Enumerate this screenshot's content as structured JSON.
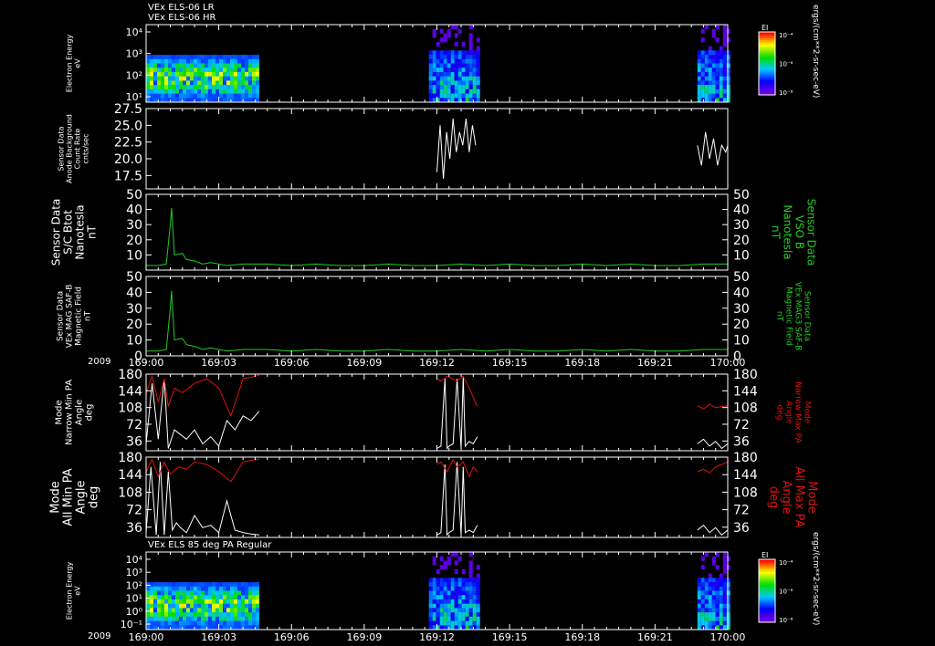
{
  "header": {
    "title_lines": [
      "VEx ELS-06 LR",
      "VEx ELS-06 HR"
    ],
    "bottom_title": "VEx ELS 85 deg PA Regular"
  },
  "time_axis": {
    "year": "2009",
    "ticks": [
      "169:00",
      "169:03",
      "169:06",
      "169:09",
      "169:12",
      "169:15",
      "169:18",
      "169:21",
      "170:00"
    ],
    "minutes": [
      0,
      180,
      360,
      540,
      720,
      900,
      1080,
      1260,
      1440
    ]
  },
  "colors": {
    "white": "#ffffff",
    "green": "#22cc22",
    "red": "#dd1111",
    "frame": "#ffffff"
  },
  "chart_data": [
    {
      "type": "heatmap",
      "ylabel": [
        "Electron Energy",
        "eV"
      ],
      "yticks": [
        "10⁴",
        "10³",
        "10²",
        "10¹"
      ],
      "colorbar_label": "EI",
      "colorbar_ticks": [
        "10⁻⁴",
        "10⁻⁶",
        "10⁻⁸"
      ],
      "colorbar_unit": "ergs/(cm**2-sr-sec-eV)",
      "data_intervals_minutes": [
        [
          0,
          280
        ],
        [
          700,
          820
        ],
        [
          1365,
          1440
        ]
      ]
    },
    {
      "type": "line",
      "ylabel": [
        "Sensor Data",
        "Anode Background",
        "Count Rate",
        "cnts/sec"
      ],
      "ylim": [
        15.5,
        27.5
      ],
      "yticks": [
        "27.5",
        "25.0",
        "22.5",
        "20.0",
        "17.5"
      ],
      "series": [
        {
          "color": "#ffffff",
          "x": [
            720,
            728,
            736,
            744,
            752,
            760,
            768,
            776,
            784,
            792,
            800,
            808,
            816
          ],
          "values": [
            18,
            25,
            17,
            24,
            20,
            26,
            21,
            24,
            22,
            26,
            21,
            25,
            22
          ]
        },
        {
          "color": "#ffffff",
          "x": [
            1365,
            1375,
            1385,
            1395,
            1405,
            1415,
            1425,
            1435,
            1440
          ],
          "values": [
            22,
            19,
            24,
            20,
            23,
            19,
            22,
            21,
            22
          ]
        }
      ]
    },
    {
      "type": "line",
      "ylabel": [
        "Sensor Data",
        "S/C Btot",
        "Nanotesla",
        "nT"
      ],
      "rlabel": [
        "Sensor Data",
        "VSO B",
        "Nanotesla",
        "nT"
      ],
      "ylim": [
        0,
        50
      ],
      "yticks": [
        "50",
        "40",
        "30",
        "20",
        "10"
      ],
      "series": [
        {
          "color": "#22cc22",
          "x": [
            0,
            30,
            50,
            60,
            63,
            70,
            90,
            100,
            120,
            140,
            160,
            200,
            240,
            300,
            360,
            420,
            480,
            540,
            600,
            660,
            720,
            780,
            840,
            900,
            960,
            1020,
            1080,
            1140,
            1200,
            1260,
            1320,
            1380,
            1440
          ],
          "values": [
            3,
            3,
            4,
            30,
            41,
            10,
            11,
            7,
            6,
            4,
            5,
            3,
            4,
            4,
            3,
            4,
            3,
            3,
            4,
            3,
            3,
            4,
            3,
            4,
            3,
            3,
            4,
            3,
            4,
            3,
            3,
            4,
            4
          ]
        }
      ]
    },
    {
      "type": "line",
      "ylabel": [
        "Sensor Data",
        "VEx MAG SAF-B",
        "Magnetic Field",
        "nT"
      ],
      "rlabel": [
        "Sensor Data",
        "VEx MAG3 SAF-B",
        "Magnetic Field",
        "nT"
      ],
      "ylim": [
        0,
        50
      ],
      "yticks": [
        "50",
        "40",
        "30",
        "20",
        "10",
        "0"
      ],
      "series": [
        {
          "color": "#22cc22",
          "x": [
            0,
            30,
            50,
            60,
            63,
            70,
            90,
            100,
            120,
            140,
            160,
            200,
            240,
            300,
            360,
            420,
            480,
            540,
            600,
            660,
            720,
            780,
            840,
            900,
            960,
            1020,
            1080,
            1140,
            1200,
            1260,
            1320,
            1380,
            1440
          ],
          "values": [
            3,
            3,
            4,
            30,
            41,
            10,
            11,
            7,
            6,
            4,
            5,
            3,
            4,
            4,
            3,
            4,
            3,
            3,
            4,
            3,
            3,
            4,
            3,
            4,
            3,
            3,
            4,
            3,
            4,
            3,
            3,
            4,
            4
          ]
        }
      ]
    },
    {
      "type": "line",
      "ylabel": [
        "Mode",
        "Narrow Min PA",
        "Angle",
        "deg"
      ],
      "rlabel": [
        "Mode",
        "Narrow Max PA",
        "Angle",
        "deg"
      ],
      "ylim": [
        15,
        180
      ],
      "yticks": [
        "180",
        "144",
        "108",
        "72",
        "36"
      ],
      "series": [
        {
          "color": "#ffffff",
          "x": [
            0,
            15,
            30,
            45,
            55,
            70,
            85,
            100,
            120,
            140,
            160,
            180,
            200,
            220,
            240,
            260,
            280
          ],
          "values": [
            30,
            160,
            40,
            170,
            20,
            60,
            50,
            40,
            60,
            30,
            45,
            25,
            80,
            60,
            90,
            80,
            100
          ]
        },
        {
          "color": "#ffffff",
          "x": [
            720,
            730,
            740,
            745,
            750,
            760,
            770,
            780,
            785,
            790,
            800,
            810,
            820
          ],
          "values": [
            20,
            25,
            170,
            20,
            25,
            30,
            170,
            20,
            175,
            25,
            35,
            30,
            45
          ]
        },
        {
          "color": "#ffffff",
          "x": [
            1365,
            1380,
            1395,
            1410,
            1425,
            1440
          ],
          "values": [
            30,
            40,
            25,
            35,
            20,
            30
          ]
        },
        {
          "color": "#dd1111",
          "x": [
            0,
            15,
            30,
            45,
            55,
            70,
            90,
            120,
            150,
            180,
            210,
            240,
            270,
            280
          ],
          "values": [
            140,
            175,
            120,
            170,
            110,
            150,
            140,
            160,
            170,
            150,
            90,
            170,
            175,
            178
          ]
        },
        {
          "color": "#dd1111",
          "x": [
            720,
            730,
            745,
            760,
            770,
            785,
            800,
            810,
            820
          ],
          "values": [
            170,
            165,
            175,
            170,
            165,
            175,
            150,
            130,
            110
          ]
        },
        {
          "color": "#dd1111",
          "x": [
            1365,
            1380,
            1395,
            1410,
            1425,
            1440
          ],
          "values": [
            112,
            105,
            115,
            108,
            110,
            112
          ]
        }
      ]
    },
    {
      "type": "line",
      "ylabel": [
        "Mode",
        "All Min PA",
        "Angle",
        "deg"
      ],
      "rlabel": [
        "Mode",
        "All Max PA",
        "Angle",
        "deg"
      ],
      "ylim": [
        15,
        180
      ],
      "yticks": [
        "180",
        "144",
        "108",
        "72",
        "36"
      ],
      "series": [
        {
          "color": "#ffffff",
          "x": [
            0,
            12,
            25,
            35,
            45,
            55,
            65,
            75,
            85,
            100,
            120,
            140,
            160,
            180,
            200,
            220,
            240,
            260,
            280
          ],
          "values": [
            25,
            160,
            20,
            170,
            20,
            150,
            30,
            45,
            35,
            25,
            60,
            35,
            40,
            25,
            90,
            30,
            25,
            22,
            20
          ]
        },
        {
          "color": "#ffffff",
          "x": [
            720,
            730,
            740,
            745,
            750,
            760,
            770,
            780,
            785,
            790,
            800,
            810,
            820
          ],
          "values": [
            20,
            25,
            165,
            20,
            25,
            30,
            170,
            20,
            160,
            25,
            30,
            25,
            40
          ]
        },
        {
          "color": "#ffffff",
          "x": [
            1365,
            1380,
            1395,
            1410,
            1425,
            1440
          ],
          "values": [
            30,
            40,
            25,
            35,
            20,
            30
          ]
        },
        {
          "color": "#dd1111",
          "x": [
            0,
            15,
            30,
            45,
            60,
            80,
            100,
            120,
            150,
            180,
            210,
            240,
            270,
            280
          ],
          "values": [
            150,
            175,
            140,
            170,
            145,
            160,
            155,
            170,
            165,
            150,
            130,
            170,
            175,
            176
          ]
        },
        {
          "color": "#dd1111",
          "x": [
            720,
            730,
            745,
            760,
            770,
            785,
            800,
            810,
            820
          ],
          "values": [
            165,
            170,
            150,
            175,
            160,
            170,
            140,
            160,
            150
          ]
        },
        {
          "color": "#dd1111",
          "x": [
            1365,
            1380,
            1395,
            1410,
            1425,
            1440
          ],
          "values": [
            150,
            155,
            148,
            160,
            165,
            170
          ]
        }
      ]
    },
    {
      "type": "heatmap",
      "ylabel": [
        "Electron Energy",
        "eV"
      ],
      "yticks": [
        "10⁴",
        "10³",
        "10²",
        "10¹",
        "10⁰",
        "10⁻¹"
      ],
      "colorbar_label": "EI",
      "colorbar_ticks": [
        "10⁻⁴",
        "10⁻⁶",
        "10⁻⁸"
      ],
      "colorbar_unit": "ergs/(cm**2-sr-sec-eV)",
      "data_intervals_minutes": [
        [
          0,
          280
        ],
        [
          700,
          820
        ],
        [
          1365,
          1440
        ]
      ]
    }
  ]
}
